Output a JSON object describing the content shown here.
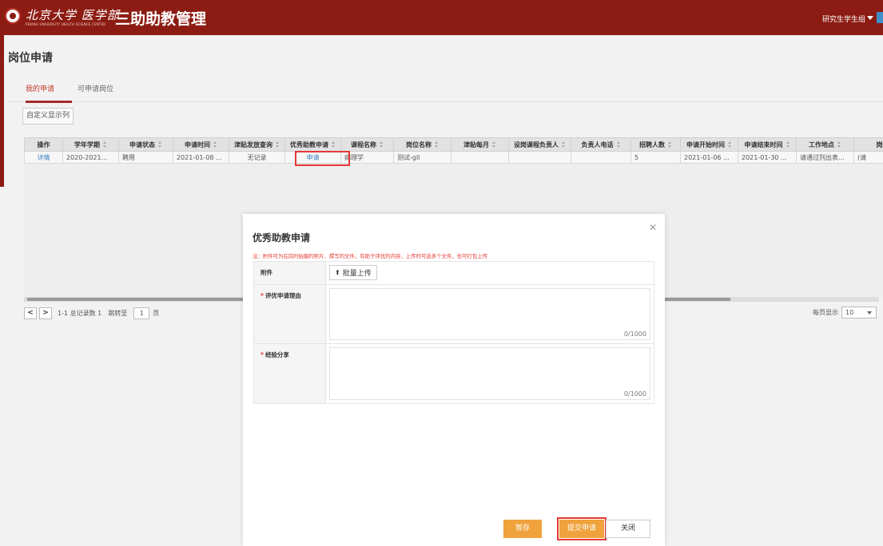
{
  "header": {
    "university_logo_text": "北京大学 医学部",
    "university_logo_subtext": "PEKING UNIVERSITY HEALTH SCIENCE CENTER",
    "system_name": "三助助教管理",
    "user_role": "研究生学生组"
  },
  "page": {
    "title": "岗位申请",
    "tabs": [
      {
        "label": "我的申请",
        "active": true
      },
      {
        "label": "可申请岗位",
        "active": false
      }
    ],
    "custom_columns_button": "自定义显示列"
  },
  "table": {
    "columns": [
      "操作",
      "学年学期",
      "申请状态",
      "申请时间",
      "津贴发放查询",
      "优秀助教申请",
      "课程名称",
      "岗位名称",
      "津贴每月",
      "设岗课程负责人",
      "负责人电话",
      "招聘人数",
      "申请开始时间",
      "申请结束时间",
      "工作地点",
      "岗位"
    ],
    "rows": [
      [
        "详情",
        "2020-2021...",
        "聘用",
        "2021-01-08 ...",
        "无记录",
        "申请",
        "病理学",
        "测试-gll",
        "",
        "",
        "",
        "5",
        "2021-01-06 ...",
        "2021-01-30 ...",
        "请通过列出表...",
        "(请"
      ]
    ]
  },
  "pager": {
    "summary": "1-1 总记录数 1",
    "jump_label": "跳转至",
    "page_value": "1",
    "page_unit": "页",
    "per_page_label": "每页显示",
    "per_page_value": "10"
  },
  "modal": {
    "title": "优秀助教申请",
    "note": "注：附件可为在岗时拍摄的照片、撰写的文件，有助于评优的内容，上传时可选多个文件，也可打包上传",
    "attachment_label": "附件",
    "upload_button": "批量上传",
    "reason_label": "评优申请理由",
    "reason_counter": "0/1000",
    "experience_label": "经验分享",
    "experience_counter": "0/1000",
    "save_button": "暂存",
    "submit_button": "提交申请",
    "close_button": "关闭"
  },
  "colors": {
    "header_bg": "#8c1c13",
    "accent_orange": "#f0a23c",
    "highlight_red": "#e53935",
    "link_blue": "#3a7fc2"
  }
}
